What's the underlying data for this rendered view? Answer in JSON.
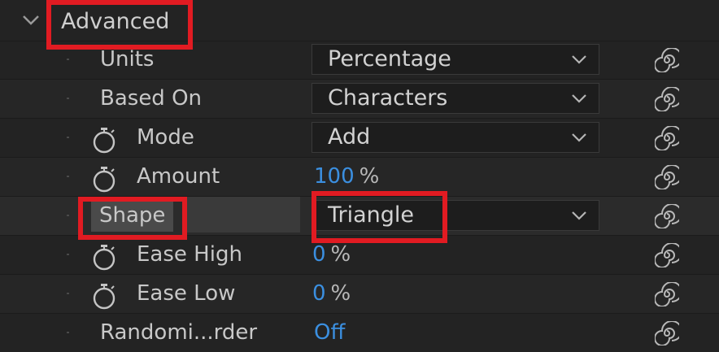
{
  "section": {
    "title": "Advanced",
    "toggle_icon": "chevron-down-icon"
  },
  "properties": [
    {
      "label": "Units",
      "type": "dropdown",
      "value": "Percentage",
      "stopwatch": false
    },
    {
      "label": "Based On",
      "type": "dropdown",
      "value": "Characters",
      "stopwatch": false
    },
    {
      "label": "Mode",
      "type": "dropdown",
      "value": "Add",
      "stopwatch": true
    },
    {
      "label": "Amount",
      "type": "number",
      "value": "100",
      "unit": "%",
      "stopwatch": true
    },
    {
      "label": "Shape",
      "type": "dropdown",
      "value": "Triangle",
      "stopwatch": false,
      "highlighted": true
    },
    {
      "label": "Ease High",
      "type": "number",
      "value": "0",
      "unit": "%",
      "stopwatch": true
    },
    {
      "label": "Ease Low",
      "type": "number",
      "value": "0",
      "unit": "%",
      "stopwatch": true
    },
    {
      "label": "Randomi...rder",
      "type": "toggle",
      "value": "Off",
      "stopwatch": false
    }
  ],
  "icons": {
    "stopwatch": "stopwatch-icon",
    "expression": "expression-spiral-icon",
    "dropdown": "chevron-down-icon"
  },
  "colors": {
    "background": "#232323",
    "value_blue": "#3b8fe0",
    "highlight_red": "#e11b22"
  }
}
